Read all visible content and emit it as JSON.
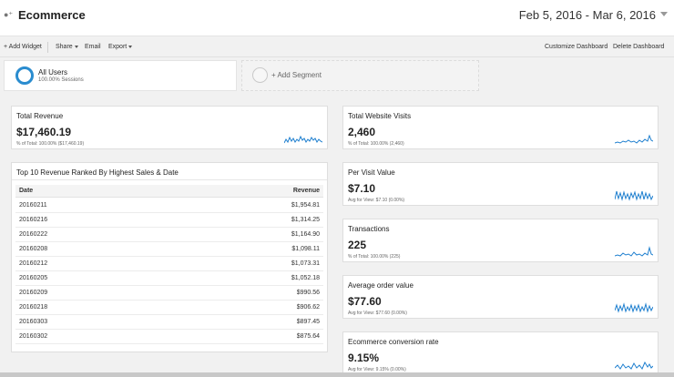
{
  "header": {
    "title": "Ecommerce",
    "date_range": "Feb 5, 2016 - Mar 6, 2016"
  },
  "toolbar": {
    "add_widget": "+ Add Widget",
    "share": "Share",
    "email": "Email",
    "export": "Export",
    "customize": "Customize Dashboard",
    "delete": "Delete Dashboard"
  },
  "segments": {
    "active": {
      "name": "All Users",
      "sub": "100.00% Sessions"
    },
    "add_label": "+ Add Segment"
  },
  "widgets": {
    "total_revenue": {
      "title": "Total Revenue",
      "value": "$17,460.19",
      "sub": "% of Total: 100.00% ($17,460.19)"
    },
    "visits": {
      "title": "Total Website Visits",
      "value": "2,460",
      "sub": "% of Total: 100.00% (2,460)"
    },
    "per_visit": {
      "title": "Per Visit Value",
      "value": "$7.10",
      "sub": "Avg for View: $7.10 (0.00%)"
    },
    "transactions": {
      "title": "Transactions",
      "value": "225",
      "sub": "% of Total: 100.00% (225)"
    },
    "aov": {
      "title": "Average order value",
      "value": "$77.60",
      "sub": "Avg for View: $77.60 (0.00%)"
    },
    "conv": {
      "title": "Ecommerce conversion rate",
      "value": "9.15%",
      "sub": "Avg for View: 9.15% (0.00%)"
    }
  },
  "table": {
    "title": "Top 10 Revenue Ranked By Highest Sales & Date",
    "headers": {
      "date": "Date",
      "revenue": "Revenue"
    },
    "rows": [
      {
        "date": "20160211",
        "revenue": "$1,954.81"
      },
      {
        "date": "20160216",
        "revenue": "$1,314.25"
      },
      {
        "date": "20160222",
        "revenue": "$1,164.90"
      },
      {
        "date": "20160208",
        "revenue": "$1,098.11"
      },
      {
        "date": "20160212",
        "revenue": "$1,073.31"
      },
      {
        "date": "20160205",
        "revenue": "$1,052.18"
      },
      {
        "date": "20160209",
        "revenue": "$990.56"
      },
      {
        "date": "20160218",
        "revenue": "$906.62"
      },
      {
        "date": "20160303",
        "revenue": "$897.45"
      },
      {
        "date": "20160302",
        "revenue": "$875.64"
      }
    ]
  },
  "colors": {
    "accent": "#2a8ccf",
    "sparkline": "#1e7fcf"
  },
  "icons": {
    "dashboard": "users-icon",
    "date_dropdown": "chevron-down-icon"
  }
}
